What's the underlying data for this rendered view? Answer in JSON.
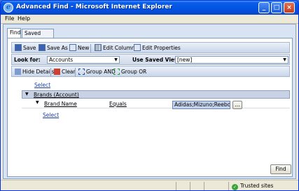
{
  "window": {
    "title": "Advanced Find - Microsoft Internet Explorer",
    "minimize_glyph": "_",
    "maximize_glyph": "□",
    "close_glyph": "×"
  },
  "menu": [
    {
      "label": "File"
    },
    {
      "label": "Help"
    }
  ],
  "tabs": [
    {
      "label": "Find",
      "active": true
    },
    {
      "label": "Saved Views",
      "active": false
    }
  ],
  "toolbar": {
    "save": "Save",
    "save_as": "Save As",
    "new": "New",
    "edit_columns": "Edit Columns",
    "edit_properties": "Edit Properties"
  },
  "query": {
    "look_for_label": "Look for:",
    "look_for_value": "Accounts",
    "saved_view_label": "Use Saved View:",
    "saved_view_value": "[new]"
  },
  "query_toolbar": {
    "hide_details": "Hide Details",
    "clear": "Clear",
    "group_and": "Group AND",
    "group_or": "Group OR"
  },
  "criteria": {
    "top_select": "Select",
    "group_label": "Brands (Account)",
    "field": "Brand Name",
    "operator": "Equals",
    "value": "Adidas;Mizuno;Reebok",
    "lookup_button": "...",
    "inner_select": "Select"
  },
  "find_button": "Find",
  "status": {
    "zone": "Trusted sites"
  },
  "colors": {
    "titlebar": "#0a5ce8",
    "panel_bg": "#d8e3f3",
    "link": "#1e3fa8"
  }
}
